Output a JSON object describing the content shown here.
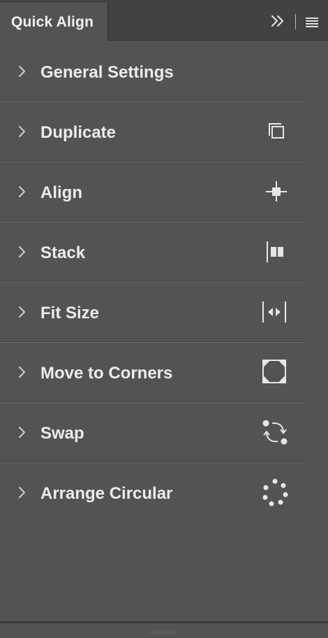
{
  "panel": {
    "tab_title": "Quick Align"
  },
  "toolbar": {
    "collapse_icon": "double-chevron-right-icon",
    "menu_icon": "hamburger-menu-icon"
  },
  "sections": [
    {
      "label": "General Settings",
      "icon": ""
    },
    {
      "label": "Duplicate",
      "icon": "duplicate-icon"
    },
    {
      "label": "Align",
      "icon": "align-center-icon"
    },
    {
      "label": "Stack",
      "icon": "stack-icon"
    },
    {
      "label": "Fit Size",
      "icon": "fit-size-icon"
    },
    {
      "label": "Move to Corners",
      "icon": "move-to-corners-icon"
    },
    {
      "label": "Swap",
      "icon": "swap-icon"
    },
    {
      "label": "Arrange Circular",
      "icon": "arrange-circular-icon"
    }
  ],
  "colors": {
    "panel_bg": "#535353",
    "tabbar_bg": "#424242",
    "text": "#ececec"
  }
}
